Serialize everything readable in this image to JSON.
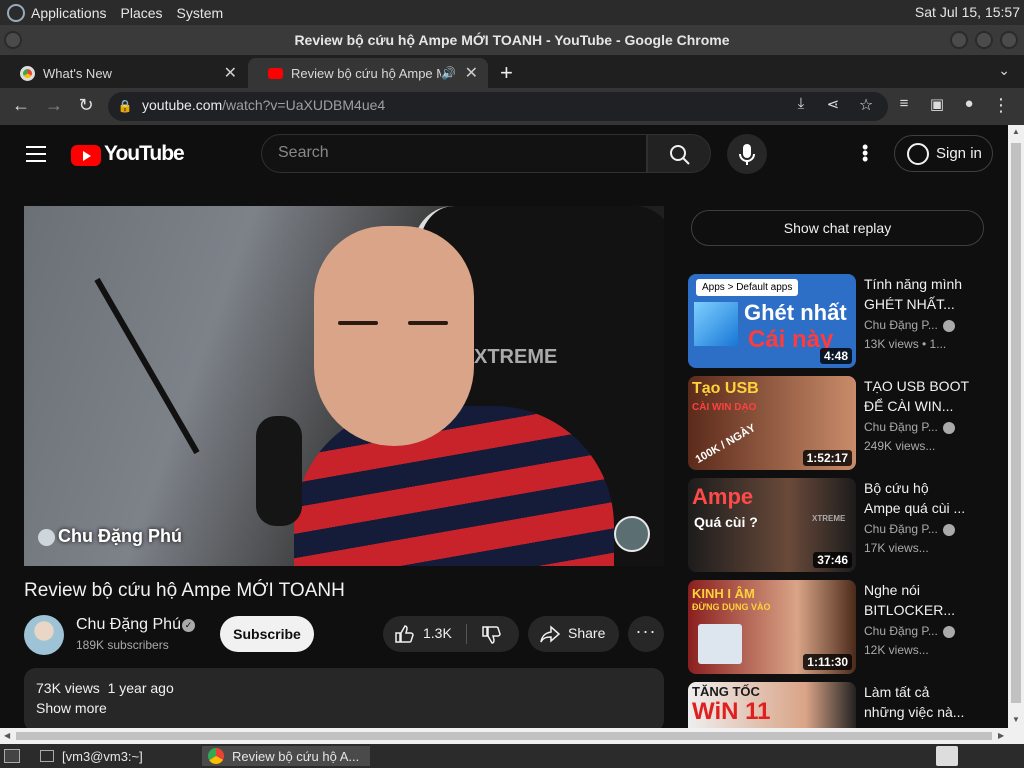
{
  "os_panel": {
    "menus": [
      "Applications",
      "Places",
      "System"
    ],
    "clock": "Sat Jul 15, 15:57"
  },
  "window": {
    "title": "Review bộ cứu hộ Ampe MỚI TOANH - YouTube - Google Chrome"
  },
  "tabs": [
    {
      "label": "What's New"
    },
    {
      "label": "Review bộ cứu hộ Ampe M"
    }
  ],
  "address": {
    "host": "youtube.com",
    "path": "/watch?v=UaXUDBM4ue4"
  },
  "yt": {
    "logo": "YouTube",
    "search_placeholder": "Search",
    "sign_in": "Sign in"
  },
  "player": {
    "caption": "Chu Đặng Phú"
  },
  "video": {
    "title": "Review bộ cứu hộ Ampe MỚI TOANH",
    "channel": "Chu Đặng Phú",
    "subscribers": "189K subscribers",
    "subscribe": "Subscribe",
    "likes": "1.3K",
    "share": "Share",
    "views": "73K views",
    "age": "1 year ago",
    "show_more": "Show more"
  },
  "sidebar": {
    "chat_replay": "Show chat replay",
    "recommendations": [
      {
        "title_l1": "Tính năng mình",
        "title_l2": "GHÉT NHẤT...",
        "channel": "Chu Đặng P...",
        "meta": "13K views • 1...",
        "duration": "4:48",
        "thumb": {
          "t1": "Apps > Default apps",
          "t2": "Ghét nhất",
          "t3": "Cái này"
        }
      },
      {
        "title_l1": "TẠO USB BOOT",
        "title_l2": "ĐỂ CÀI WIN...",
        "channel": "Chu Đặng P...",
        "meta": "249K views...",
        "duration": "1:52:17",
        "thumb": {
          "t1": "Tạo USB",
          "t2": "CÀI WIN DẠO",
          "t3": "100K / NGÀY"
        }
      },
      {
        "title_l1": "Bộ cứu hộ",
        "title_l2": "Ampe quá cùi ...",
        "channel": "Chu Đặng P...",
        "meta": "17K views...",
        "duration": "37:46",
        "thumb": {
          "t1": "Ampe",
          "t2": "Quá cùi ?",
          "t3": "XTREME"
        }
      },
      {
        "title_l1": "Nghe nói",
        "title_l2": "BITLOCKER...",
        "channel": "Chu Đặng P...",
        "meta": "12K views...",
        "duration": "1:11:30",
        "thumb": {
          "t1": "KINH I ÂM",
          "t2": "ĐỪNG DỤNG VÀO",
          "t3": ""
        }
      },
      {
        "title_l1": "Làm tất cả",
        "title_l2": "những việc nà...",
        "channel": "",
        "meta": "",
        "duration": "",
        "thumb": {
          "t1": "TĂNG TỐC",
          "t2": "WiN 11",
          "t3": ""
        }
      }
    ]
  },
  "taskbar": {
    "items": [
      "[vm3@vm3:~]",
      "Review bộ cứu hộ A..."
    ]
  }
}
